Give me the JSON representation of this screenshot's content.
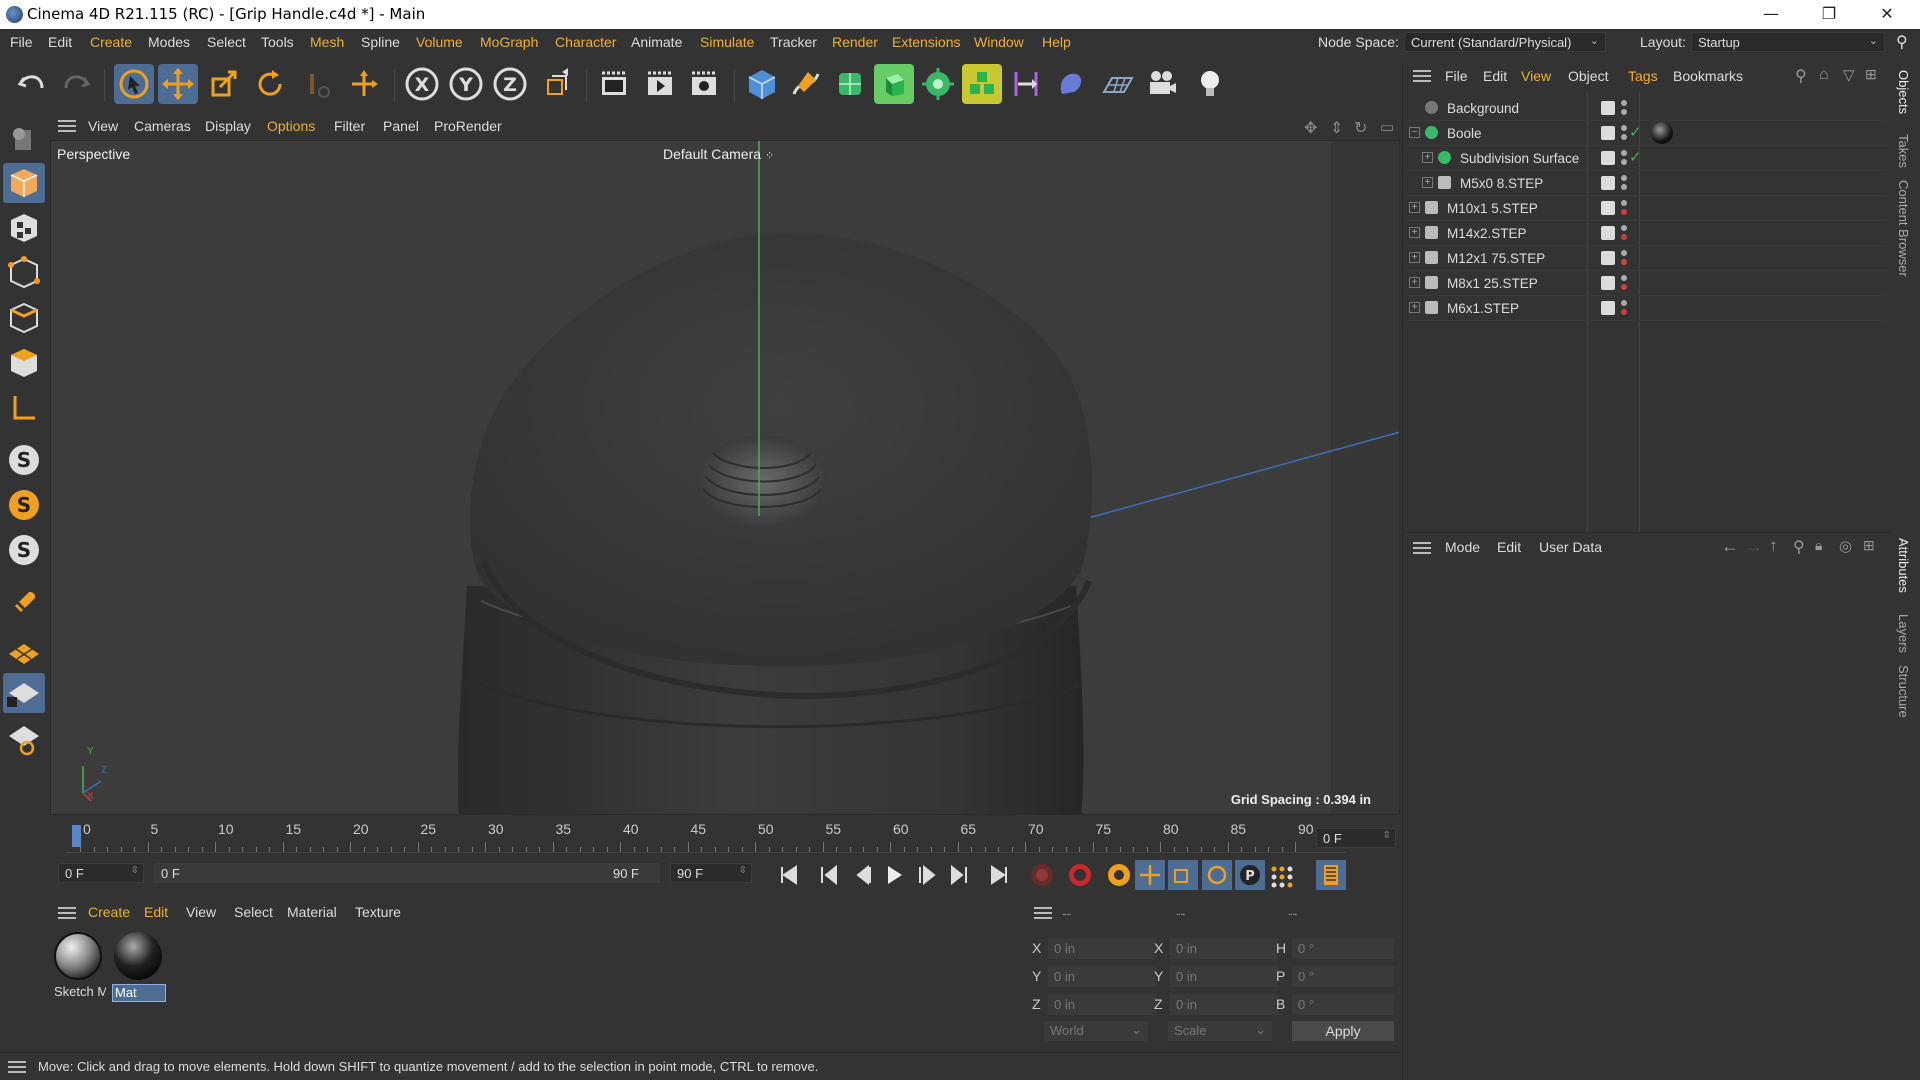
{
  "window": {
    "title": "Cinema 4D R21.115 (RC) - [Grip Handle.c4d *] - Main",
    "min": "—",
    "max": "❐",
    "close": "✕"
  },
  "menubar": {
    "items": [
      "File",
      "Edit",
      "Create",
      "Modes",
      "Select",
      "Tools",
      "Mesh",
      "Spline",
      "Volume",
      "MoGraph",
      "Character",
      "Animate",
      "Simulate",
      "Tracker",
      "Render",
      "Extensions",
      "Window",
      "Help"
    ],
    "node_space_label": "Node Space:",
    "node_space_value": "Current (Standard/Physical)",
    "layout_label": "Layout:",
    "layout_value": "Startup"
  },
  "viewport": {
    "menu": [
      "View",
      "Cameras",
      "Display",
      "Options",
      "Filter",
      "Panel",
      "ProRender"
    ],
    "label": "Perspective",
    "camera": "Default Camera",
    "grid_spacing": "Grid Spacing : 0.394 in",
    "axis": {
      "y": "Y",
      "z": "Z",
      "x": "X"
    }
  },
  "timeline": {
    "ticks": [
      "0",
      "5",
      "10",
      "15",
      "20",
      "25",
      "30",
      "35",
      "40",
      "45",
      "50",
      "55",
      "60",
      "65",
      "70",
      "75",
      "80",
      "85",
      "90"
    ],
    "current_frame": "0 F",
    "start": "0 F",
    "range_start": "0 F",
    "range_end": "90 F",
    "end": "90 F"
  },
  "material_manager": {
    "menu": [
      "Create",
      "Edit",
      "View",
      "Select",
      "Material",
      "Texture"
    ],
    "materials": [
      {
        "name": "Sketch M"
      },
      {
        "name": "Mat"
      }
    ]
  },
  "coordinates": {
    "headers": [
      "--",
      "--",
      "--"
    ],
    "rows": [
      {
        "a": "X",
        "av": "0 in",
        "b": "X",
        "bv": "0 in",
        "c": "H",
        "cv": "0 °"
      },
      {
        "a": "Y",
        "av": "0 in",
        "b": "Y",
        "bv": "0 in",
        "c": "P",
        "cv": "0 °"
      },
      {
        "a": "Z",
        "av": "0 in",
        "b": "Z",
        "bv": "0 in",
        "c": "B",
        "cv": "0 °"
      }
    ],
    "mode": "World",
    "type": "Scale",
    "apply": "Apply"
  },
  "status": {
    "message": "Move: Click and drag to move elements. Hold down SHIFT to quantize movement / add to the selection in point mode, CTRL to remove."
  },
  "object_manager": {
    "menu": [
      "File",
      "Edit",
      "View",
      "Object",
      "Tags",
      "Bookmarks"
    ],
    "objects": [
      {
        "name": "Background",
        "indent": 0,
        "expand": "",
        "icon": "background"
      },
      {
        "name": "Boole",
        "indent": 0,
        "expand": "−",
        "icon": "boole"
      },
      {
        "name": "Subdivision Surface",
        "indent": 1,
        "expand": "+",
        "icon": "subdiv"
      },
      {
        "name": "M5x0 8.STEP",
        "indent": 1,
        "expand": "+",
        "icon": "null"
      },
      {
        "name": "M10x1 5.STEP",
        "indent": 0,
        "expand": "+",
        "icon": "null"
      },
      {
        "name": "M14x2.STEP",
        "indent": 0,
        "expand": "+",
        "icon": "null"
      },
      {
        "name": "M12x1 75.STEP",
        "indent": 0,
        "expand": "+",
        "icon": "null"
      },
      {
        "name": "M8x1 25.STEP",
        "indent": 0,
        "expand": "+",
        "icon": "null"
      },
      {
        "name": "M6x1.STEP",
        "indent": 0,
        "expand": "+",
        "icon": "null"
      }
    ]
  },
  "attribute_manager": {
    "menu": [
      "Mode",
      "Edit",
      "User Data"
    ]
  },
  "right_tabs": [
    "Objects",
    "Takes",
    "Content Browser",
    "Attributes",
    "Layers",
    "Structure"
  ]
}
